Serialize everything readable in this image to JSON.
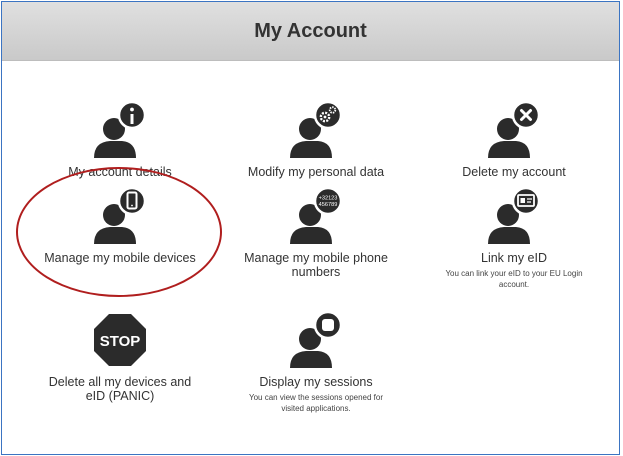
{
  "header": {
    "title": "My Account"
  },
  "tiles": [
    {
      "label": "My account details",
      "desc": "",
      "icon": "person-info-icon"
    },
    {
      "label": "Modify my personal data",
      "desc": "",
      "icon": "person-gears-icon"
    },
    {
      "label": "Delete my account",
      "desc": "",
      "icon": "person-delete-icon"
    },
    {
      "label": "Manage my mobile devices",
      "desc": "",
      "icon": "person-mobile-icon"
    },
    {
      "label": "Manage my mobile phone numbers",
      "desc": "",
      "icon": "person-phone-number-icon",
      "icon_text_1": "+32123",
      "icon_text_2": "456789"
    },
    {
      "label": "Link my eID",
      "desc": "You can link your eID to your EU Login account.",
      "icon": "person-id-card-icon"
    },
    {
      "label": "Delete all my devices and eID (PANIC)",
      "desc": "",
      "icon": "stop-sign-icon",
      "icon_text": "STOP"
    },
    {
      "label": "Display my sessions",
      "desc": "You can view the sessions opened for visited applications.",
      "icon": "person-sessions-icon"
    }
  ],
  "colors": {
    "icon": "#2b2b2b",
    "highlight": "#b01e1e",
    "border": "#3b74c2"
  }
}
